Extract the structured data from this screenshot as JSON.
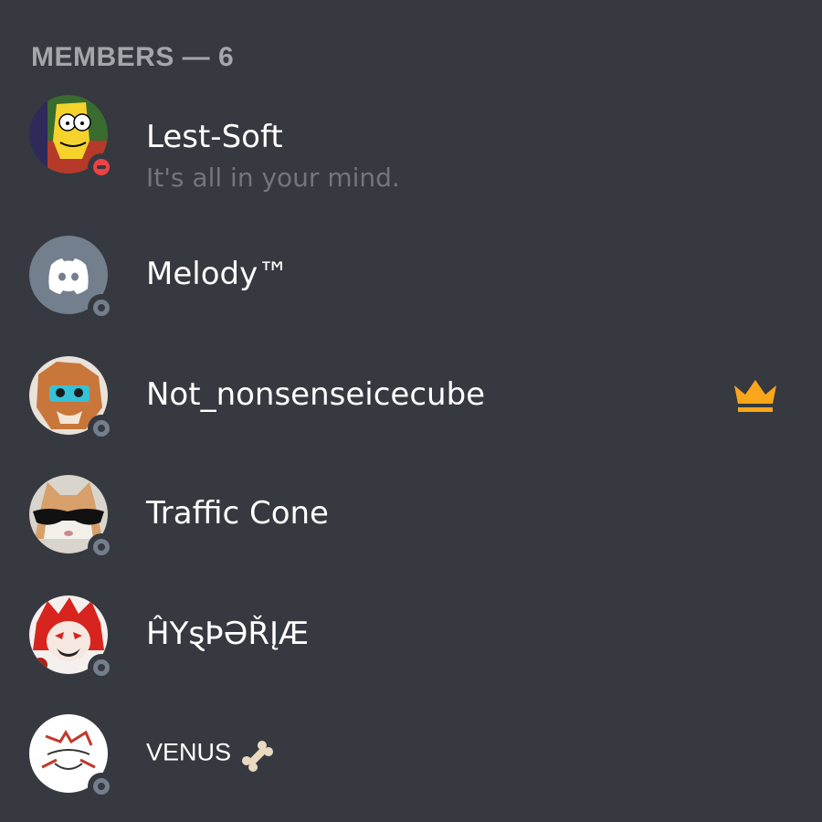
{
  "header": {
    "title": "MEMBERS — 6"
  },
  "members": [
    {
      "name": "Lest-Soft",
      "status_text": "It's all in your mind.",
      "presence": "dnd",
      "avatar_icon": "cartoon-character-avatar",
      "owner": false
    },
    {
      "name": "Melody™",
      "status_text": "",
      "presence": "offline",
      "avatar_icon": "discord-default-avatar",
      "owner": false
    },
    {
      "name": "Not_nonsenseicecube",
      "status_text": "",
      "presence": "offline",
      "avatar_icon": "furry-character-avatar",
      "owner": true
    },
    {
      "name": "Traffic Cone",
      "status_text": "",
      "presence": "offline",
      "avatar_icon": "cat-sunglasses-avatar",
      "owner": false
    },
    {
      "name": "ĤYȿÞƏŘĮÆ",
      "status_text": "",
      "presence": "offline",
      "avatar_icon": "red-anime-character-avatar",
      "owner": false
    },
    {
      "name": "VENUS",
      "status_text": "",
      "presence": "offline",
      "avatar_icon": "white-sketch-avatar",
      "owner": false,
      "name_emoji": "bone-emoji"
    }
  ],
  "colors": {
    "background": "#36393f",
    "header_text": "#a3a6aa",
    "status_text": "#72767d",
    "offline": "#747f8d",
    "dnd": "#ed4245",
    "crown": "#faa61a",
    "blurple": "#5865f2"
  }
}
